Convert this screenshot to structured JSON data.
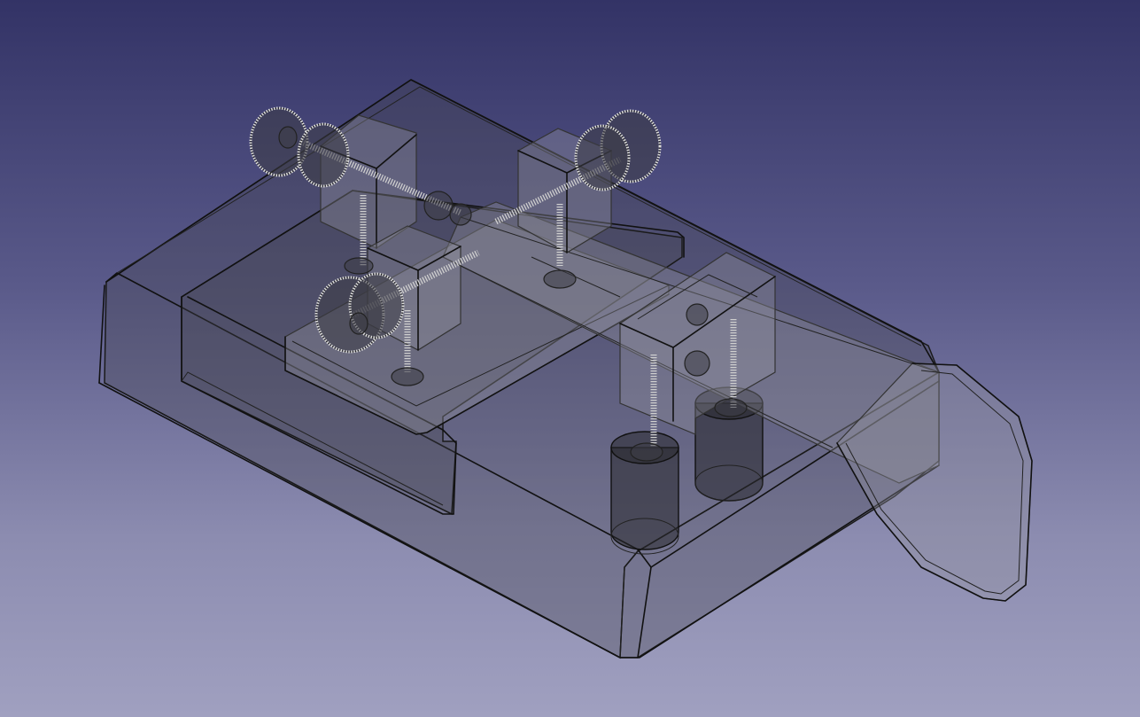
{
  "viewer": {
    "background_top": "#333366",
    "background_bottom": "#a0a0c0",
    "display_mode": "transparent",
    "model_color": "#505058"
  }
}
